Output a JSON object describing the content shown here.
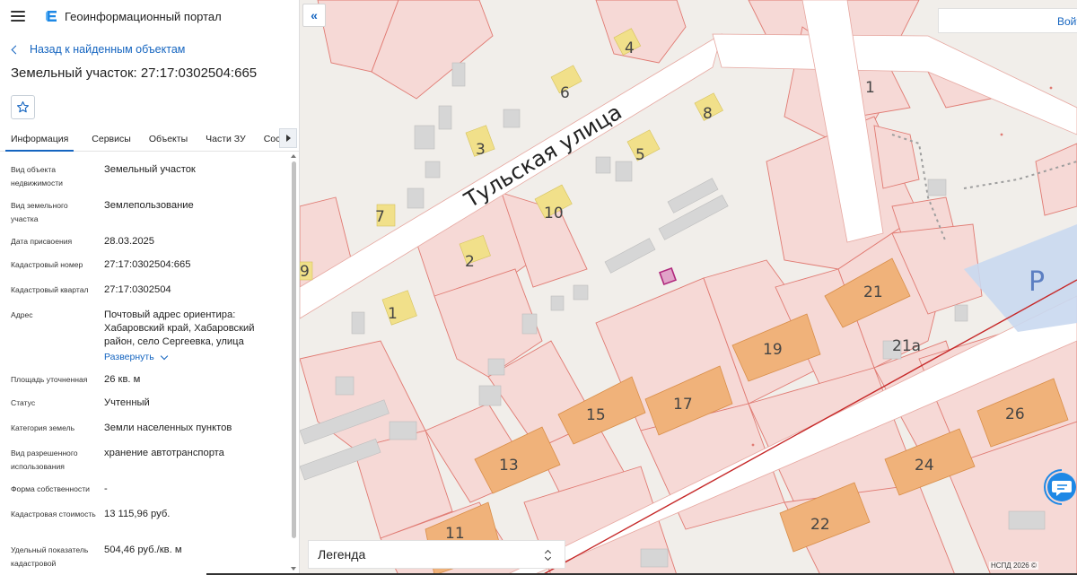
{
  "header": {
    "app_title": "Геоинформационный портал"
  },
  "navigation": {
    "back_label": "Назад к найденным объектам",
    "collapse_icon": "«"
  },
  "object": {
    "title": "Земельный участок: 27:17:0302504:665"
  },
  "tabs": [
    {
      "label": "Информация",
      "active": true
    },
    {
      "label": "Сервисы"
    },
    {
      "label": "Объекты"
    },
    {
      "label": "Части ЗУ"
    },
    {
      "label": "Состав"
    }
  ],
  "properties": [
    {
      "key": "Вид объекта недвижимости",
      "value": "Земельный участок"
    },
    {
      "key": "Вид земельного участка",
      "value": "Землепользование"
    },
    {
      "key": "Дата присвоения",
      "value": "28.03.2025"
    },
    {
      "key": "Кадастровый номер",
      "value": "27:17:0302504:665"
    },
    {
      "key": "Кадастровый квартал",
      "value": "27:17:0302504"
    },
    {
      "key": "Адрес",
      "value": "Почтовый адрес ориентира: Хабаровский край, Хабаровский район, село Сергеевка, улица",
      "expand_label": "Развернуть"
    },
    {
      "key": "Площадь уточненная",
      "value": "26 кв. м"
    },
    {
      "key": "Статус",
      "value": "Учтенный"
    },
    {
      "key": "Категория земель",
      "value": "Земли населенных пунктов"
    },
    {
      "key": "Вид разрешенного использования",
      "value": "хранение автотранспорта"
    },
    {
      "key": "Форма собственности",
      "value": "-"
    },
    {
      "key": "Кадастровая стоимость",
      "value": "13 115,96 руб."
    },
    {
      "key": "Удельный показатель кадастровой",
      "value": "504,46 руб./кв. м"
    }
  ],
  "map": {
    "street_label": "Тульская улица",
    "login_label": "Войти",
    "legend_label": "Легенда",
    "copyright": "НСПД 2026 ©",
    "parking_label": "P",
    "house_numbers": [
      "4",
      "6",
      "1",
      "8",
      "3",
      "5",
      "10",
      "7",
      "2",
      "9",
      "1",
      "21",
      "21а",
      "19",
      "15",
      "17",
      "26",
      "13",
      "24",
      "22",
      "11"
    ],
    "colors": {
      "parcel_fill": "#f6d9d6",
      "parcel_stroke": "#e07a72",
      "building_orange": "#f0b27a",
      "building_yellow": "#f1e08a",
      "building_gray": "#d6d6d6",
      "road": "#ffffff",
      "selected_parcel": "#b0287c",
      "rail_line": "#c62828"
    }
  }
}
